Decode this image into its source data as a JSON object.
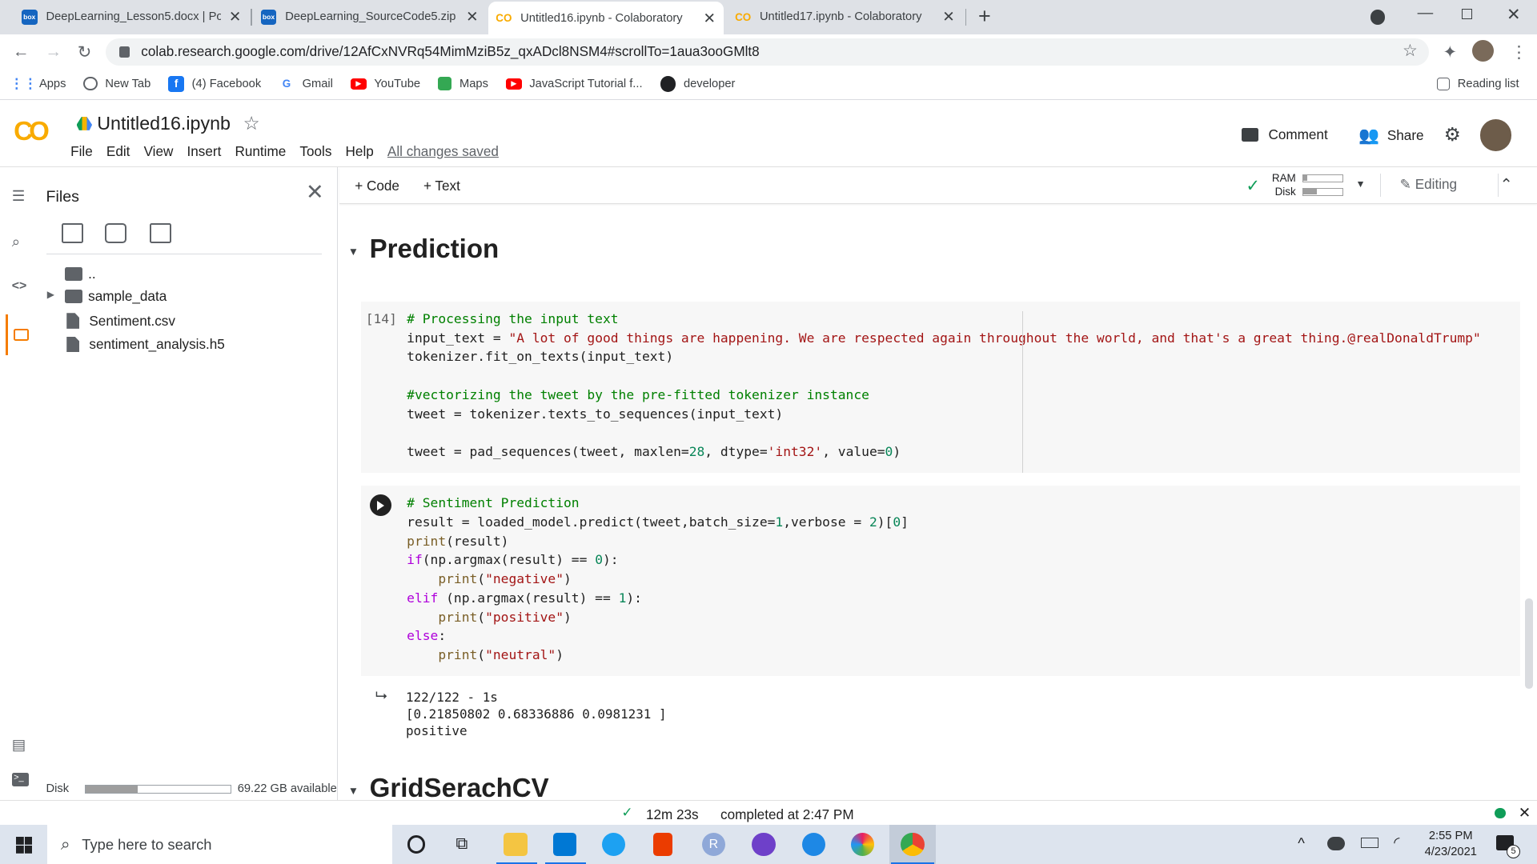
{
  "browser": {
    "tabs": [
      {
        "title": "DeepLearning_Lesson5.docx | Po",
        "icon": "box",
        "active": false
      },
      {
        "title": "DeepLearning_SourceCode5.zip |",
        "icon": "box",
        "active": false
      },
      {
        "title": "Untitled16.ipynb - Colaboratory",
        "icon": "colab",
        "active": true
      },
      {
        "title": "Untitled17.ipynb - Colaboratory",
        "icon": "colab",
        "active": false
      }
    ],
    "box_label": "box",
    "url": "colab.research.google.com/drive/12AfCxNVRq54MimMziB5z_qxADcl8NSM4#scrollTo=1aua3ooGMlt8",
    "bookmarks": [
      "Apps",
      "New Tab",
      "(4) Facebook",
      "Gmail",
      "YouTube",
      "Maps",
      "JavaScript Tutorial f...",
      "developer"
    ],
    "reading_list": "Reading list"
  },
  "colab": {
    "logo": "CO",
    "notebook_title": "Untitled16.ipynb",
    "menus": [
      "File",
      "Edit",
      "View",
      "Insert",
      "Runtime",
      "Tools",
      "Help"
    ],
    "save_status": "All changes saved",
    "comment_label": "Comment",
    "share_label": "Share",
    "add_code": "+ Code",
    "add_text": "+ Text",
    "ram_label": "RAM",
    "disk_label": "Disk",
    "editing_label": "Editing"
  },
  "files_panel": {
    "title": "Files",
    "items": [
      "..",
      "sample_data",
      "Sentiment.csv",
      "sentiment_analysis.h5"
    ],
    "disk_label": "Disk",
    "disk_available": "69.22 GB available",
    "disk_fraction": 0.36
  },
  "notebook": {
    "section1": "Prediction",
    "cell1_exec": "[14]",
    "cell1_lines": [
      "# Processing the input text",
      "input_text = \"A lot of good things are happening. We are respected again throughout the world, and that's a great thing.@realDonaldTrump\"",
      "tokenizer.fit_on_texts(input_text)",
      "",
      "#vectorizing the tweet by the pre-fitted tokenizer instance",
      "tweet = tokenizer.texts_to_sequences(input_text)",
      "",
      "tweet = pad_sequences(tweet, maxlen=28, dtype='int32', value=0)"
    ],
    "cell2_lines": [
      "# Sentiment Prediction",
      "result = loaded_model.predict(tweet,batch_size=1,verbose = 2)[0]",
      "print(result)",
      "if(np.argmax(result) == 0):",
      "    print(\"negative\")",
      "elif (np.argmax(result) == 1):",
      "    print(\"positive\")",
      "else:",
      "    print(\"neutral\")"
    ],
    "output_lines": [
      "122/122 - 1s",
      "[0.21850802 0.68336886 0.0981231 ]",
      "positive"
    ],
    "section2": "GridSerachCV"
  },
  "status": {
    "elapsed": "12m 23s",
    "completed": "completed at 2:47 PM"
  },
  "taskbar": {
    "search_placeholder": "Type here to search",
    "time": "2:55 PM",
    "date": "4/23/2021",
    "notifications": "5"
  }
}
